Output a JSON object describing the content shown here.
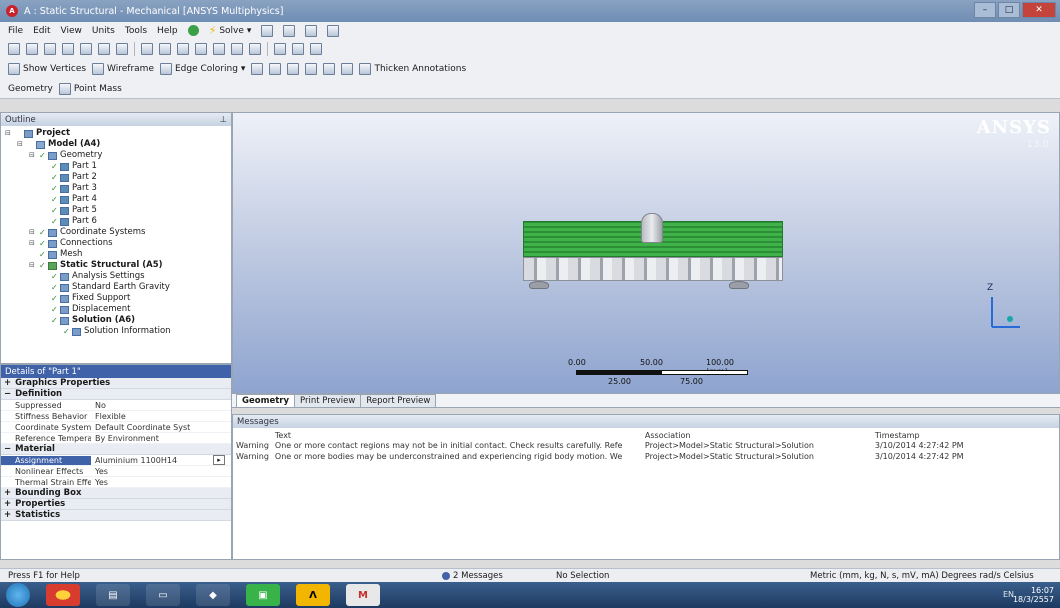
{
  "window": {
    "title": "A : Static Structural - Mechanical [ANSYS Multiphysics]",
    "app_icon": "A"
  },
  "menu": {
    "items": [
      "File",
      "Edit",
      "View",
      "Units",
      "Tools",
      "Help"
    ],
    "solve_label": "Solve"
  },
  "toolbar2": {
    "show_vertices": "Show Vertices",
    "wireframe": "Wireframe",
    "edge_coloring": "Edge Coloring",
    "thicken_annotations": "Thicken Annotations"
  },
  "toolbar3": {
    "geometry": "Geometry",
    "point_mass": "Point Mass"
  },
  "outline": {
    "title": "Outline",
    "rows": [
      {
        "label": "Project",
        "level": 0,
        "bold": true,
        "icon": "project"
      },
      {
        "label": "Model (A4)",
        "level": 1,
        "bold": true,
        "icon": "model"
      },
      {
        "label": "Geometry",
        "level": 2,
        "bold": false,
        "icon": "geometry"
      },
      {
        "label": "Part 1",
        "level": 3,
        "bold": false,
        "icon": "part"
      },
      {
        "label": "Part 2",
        "level": 3,
        "bold": false,
        "icon": "part"
      },
      {
        "label": "Part 3",
        "level": 3,
        "bold": false,
        "icon": "part"
      },
      {
        "label": "Part 4",
        "level": 3,
        "bold": false,
        "icon": "part"
      },
      {
        "label": "Part 5",
        "level": 3,
        "bold": false,
        "icon": "part"
      },
      {
        "label": "Part 6",
        "level": 3,
        "bold": false,
        "icon": "part"
      },
      {
        "label": "Coordinate Systems",
        "level": 2,
        "bold": false,
        "icon": "coordinate"
      },
      {
        "label": "Connections",
        "level": 2,
        "bold": false,
        "icon": "connections"
      },
      {
        "label": "Mesh",
        "level": 2,
        "bold": false,
        "icon": "mesh"
      },
      {
        "label": "Static Structural (A5)",
        "level": 2,
        "bold": true,
        "icon": "static"
      },
      {
        "label": "Analysis Settings",
        "level": 3,
        "bold": false,
        "icon": "settings"
      },
      {
        "label": "Standard Earth Gravity",
        "level": 3,
        "bold": false,
        "icon": "gravity"
      },
      {
        "label": "Fixed Support",
        "level": 3,
        "bold": false,
        "icon": "support"
      },
      {
        "label": "Displacement",
        "level": 3,
        "bold": false,
        "icon": "displacement"
      },
      {
        "label": "Solution (A6)",
        "level": 3,
        "bold": true,
        "icon": "solution"
      },
      {
        "label": "Solution Information",
        "level": 4,
        "bold": false,
        "icon": "info"
      }
    ]
  },
  "details": {
    "title": "Details of \"Part 1\"",
    "sections": [
      {
        "name": "Graphics Properties",
        "collapsed": true,
        "rows": []
      },
      {
        "name": "Definition",
        "collapsed": false,
        "rows": [
          {
            "k": "Suppressed",
            "v": "No"
          },
          {
            "k": "Stiffness Behavior",
            "v": "Flexible"
          },
          {
            "k": "Coordinate System",
            "v": "Default Coordinate Syst"
          },
          {
            "k": "Reference Temperature",
            "v": "By Environment"
          }
        ]
      },
      {
        "name": "Material",
        "collapsed": false,
        "rows": [
          {
            "k": "Assignment",
            "v": "Aluminium 1100H14",
            "selected": true
          },
          {
            "k": "Nonlinear Effects",
            "v": "Yes"
          },
          {
            "k": "Thermal Strain Effects",
            "v": "Yes"
          }
        ]
      },
      {
        "name": "Bounding Box",
        "collapsed": true,
        "rows": []
      },
      {
        "name": "Properties",
        "collapsed": true,
        "rows": []
      },
      {
        "name": "Statistics",
        "collapsed": true,
        "rows": []
      }
    ]
  },
  "viewport": {
    "brand": "ANSYS",
    "brand_sub": "13.0",
    "scale": {
      "t0": "0.00",
      "t1": "50.00",
      "t2": "100.00 (mm)",
      "t3": "25.00",
      "t4": "75.00"
    },
    "triad_label": "Z"
  },
  "tabs": [
    "Geometry",
    "Print Preview",
    "Report Preview"
  ],
  "messages": {
    "title": "Messages",
    "columns": [
      "",
      "Text",
      "Association",
      "Timestamp"
    ],
    "rows": [
      {
        "sev": "Warning",
        "text": "One or more contact regions may not be in initial contact.  Check results carefully.  Refe",
        "assoc": "Project>Model>Static Structural>Solution",
        "time": "3/10/2014 4:27:42 PM"
      },
      {
        "sev": "Warning",
        "text": "One or more bodies may be underconstrained and experiencing rigid body motion. We",
        "assoc": "Project>Model>Static Structural>Solution",
        "time": "3/10/2014 4:27:42 PM"
      }
    ]
  },
  "status": {
    "help": "Press F1 for Help",
    "messages": "2 Messages",
    "selection": "No Selection",
    "units": "Metric (mm, kg, N, s, mV, mA)  Degrees  rad/s  Celsius"
  },
  "taskbar": {
    "buttons": [
      "start",
      "chrome",
      "explorer",
      "folder",
      "ansys-workbench",
      "line",
      "ansys",
      "gmail"
    ],
    "time": "16:07",
    "date": "18/3/2557",
    "lang": "EN"
  }
}
